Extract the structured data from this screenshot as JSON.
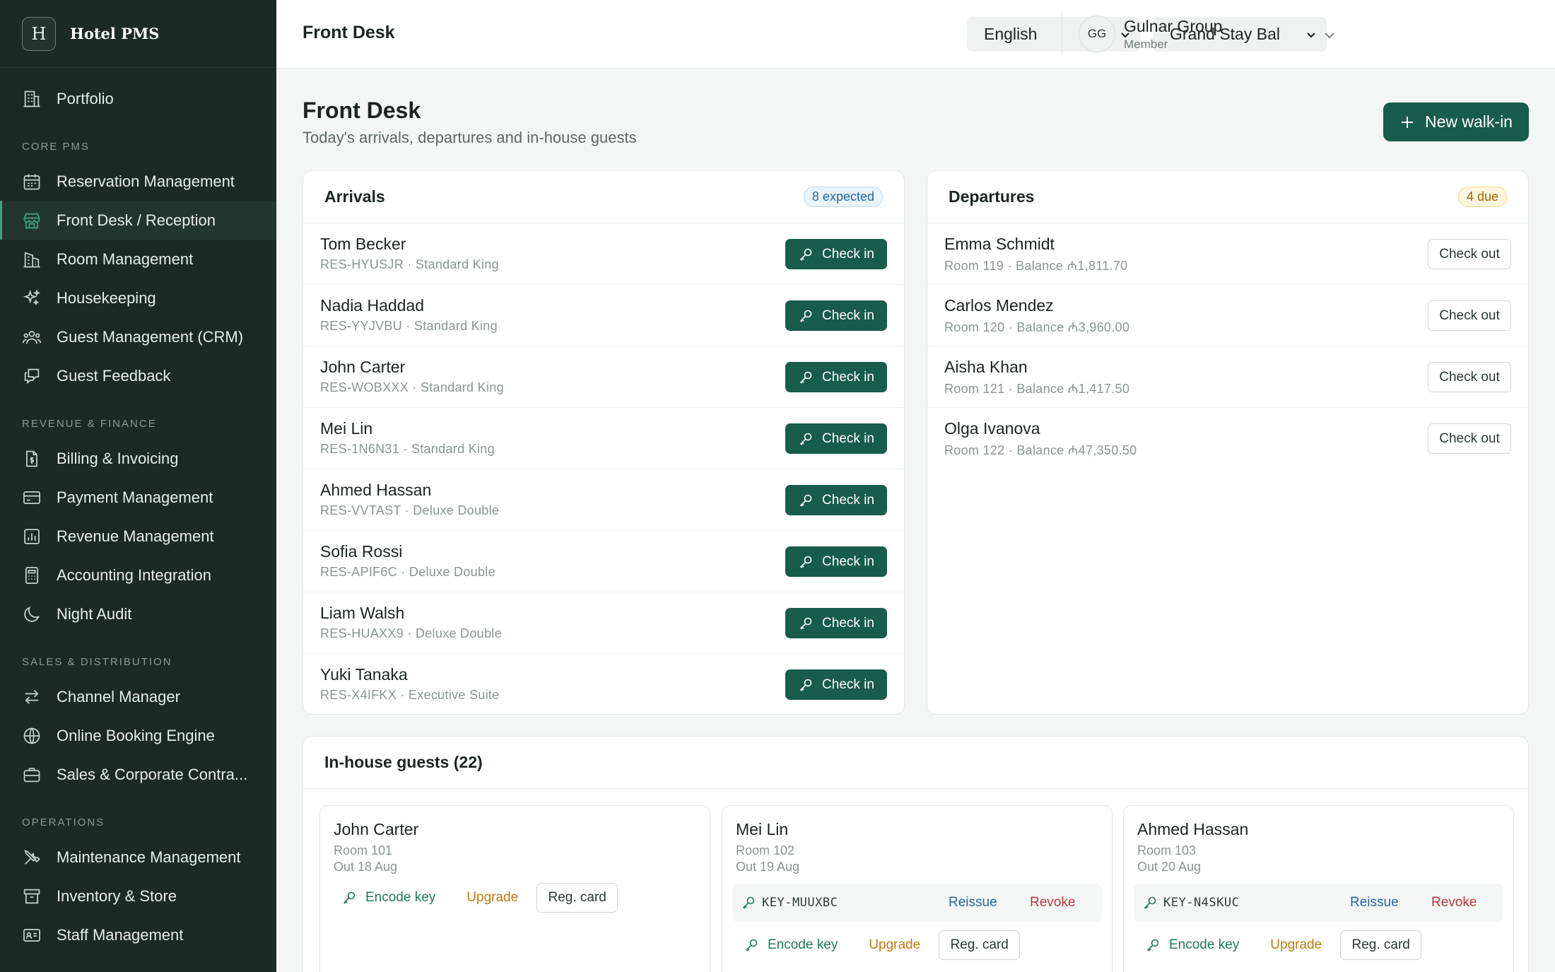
{
  "app": {
    "brand_letter": "H",
    "brand_name": "Hotel PMS"
  },
  "sidebar": {
    "portfolio": "Portfolio",
    "sections": {
      "core": "CORE PMS",
      "revenue": "REVENUE & FINANCE",
      "sales": "SALES & DISTRIBUTION",
      "operations": "OPERATIONS"
    },
    "items": {
      "reservation": "Reservation Management",
      "frontdesk": "Front Desk / Reception",
      "room": "Room Management",
      "housekeeping": "Housekeeping",
      "crm": "Guest Management (CRM)",
      "feedback": "Guest Feedback",
      "billing": "Billing & Invoicing",
      "payment": "Payment Management",
      "revenue": "Revenue Management",
      "accounting": "Accounting Integration",
      "nightaudit": "Night Audit",
      "channel": "Channel Manager",
      "booking": "Online Booking Engine",
      "corporate": "Sales & Corporate Contra...",
      "maintenance": "Maintenance Management",
      "inventory": "Inventory & Store",
      "staff": "Staff Management"
    }
  },
  "topbar": {
    "title": "Front Desk",
    "language": "English",
    "property": "Grand Stay Bal",
    "user_initials": "GG",
    "user_name": "Gulnar Group",
    "user_role": "Member"
  },
  "page": {
    "title": "Front Desk",
    "subtitle": "Today's arrivals, departures and in-house guests",
    "new_walkin": "New walk-in"
  },
  "arrivals": {
    "title": "Arrivals",
    "badge": "8 expected",
    "action_label": "Check in",
    "rows": [
      {
        "name": "Tom Becker",
        "detail": "RES-HYUSJR · Standard King"
      },
      {
        "name": "Nadia Haddad",
        "detail": "RES-YYJVBU · Standard King"
      },
      {
        "name": "John Carter",
        "detail": "RES-WOBXXX · Standard King"
      },
      {
        "name": "Mei Lin",
        "detail": "RES-1N6N31 · Standard King"
      },
      {
        "name": "Ahmed Hassan",
        "detail": "RES-VVTAST · Deluxe Double"
      },
      {
        "name": "Sofia Rossi",
        "detail": "RES-APIF6C · Deluxe Double"
      },
      {
        "name": "Liam Walsh",
        "detail": "RES-HUAXX9 · Deluxe Double"
      },
      {
        "name": "Yuki Tanaka",
        "detail": "RES-X4IFKX · Executive Suite"
      }
    ]
  },
  "departures": {
    "title": "Departures",
    "badge": "4 due",
    "action_label": "Check out",
    "rows": [
      {
        "name": "Emma Schmidt",
        "detail": "Room 119 · Balance ₼1,811.70"
      },
      {
        "name": "Carlos Mendez",
        "detail": "Room 120 · Balance ₼3,960.00"
      },
      {
        "name": "Aisha Khan",
        "detail": "Room 121 · Balance ₼1,417.50"
      },
      {
        "name": "Olga Ivanova",
        "detail": "Room 122 · Balance ₼47,350.50"
      }
    ]
  },
  "inhouse": {
    "title": "In-house guests (22)",
    "encode_label": "Encode key",
    "upgrade_label": "Upgrade",
    "regcard_label": "Reg. card",
    "reissue_label": "Reissue",
    "revoke_label": "Revoke",
    "guests": [
      {
        "name": "John Carter",
        "room": "Room 101",
        "out": "Out 18 Aug",
        "key": ""
      },
      {
        "name": "Mei Lin",
        "room": "Room 102",
        "out": "Out 19 Aug",
        "key": "KEY-MUUXBC"
      },
      {
        "name": "Ahmed Hassan",
        "room": "Room 103",
        "out": "Out 20 Aug",
        "key": "KEY-N4SKUC"
      }
    ]
  },
  "colors": {
    "sidebar_bg": "#1b2a25",
    "primary": "#185c4a",
    "accent": "#3fa37f"
  }
}
